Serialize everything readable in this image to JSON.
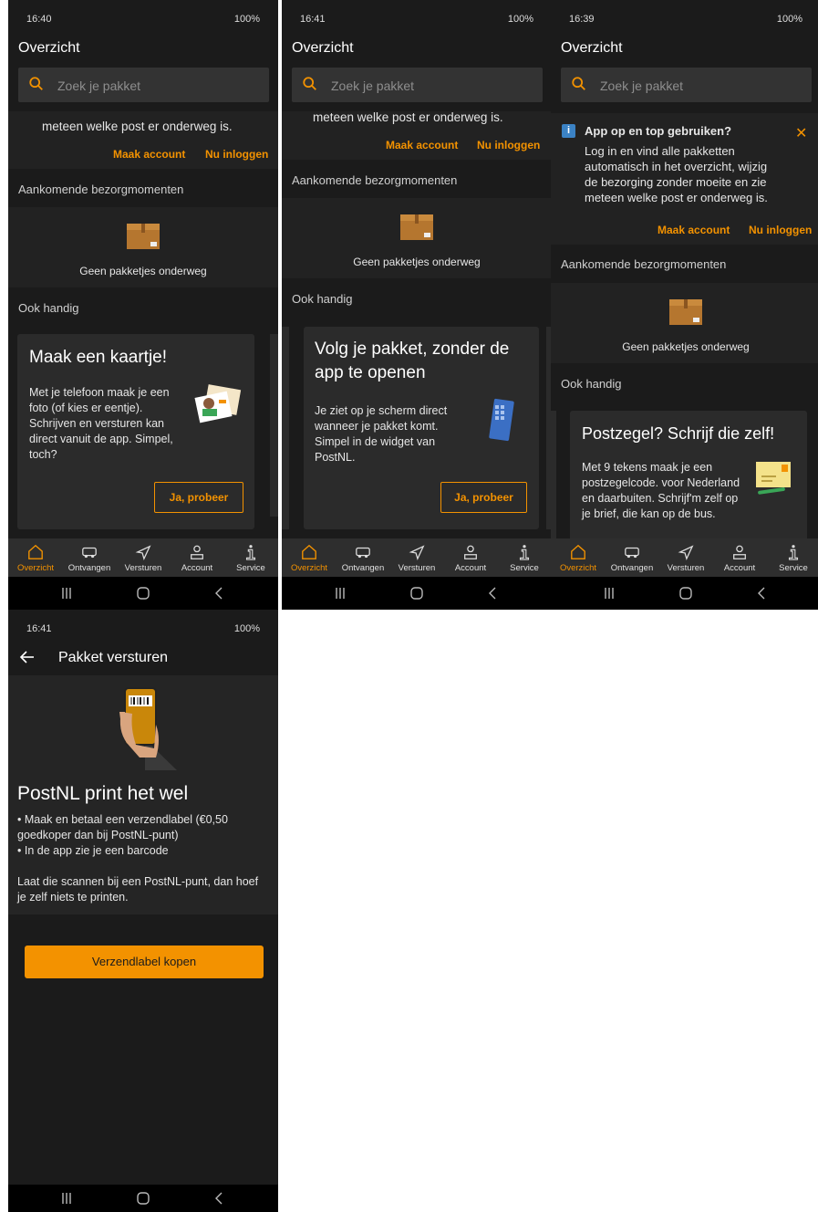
{
  "common": {
    "title": "Overzicht",
    "search_placeholder": "Zoek je pakket",
    "section_upcoming": "Aankomende bezorgmomenten",
    "no_packages": "Geen pakketjes onderweg",
    "section_handy": "Ook handig",
    "make_account": "Maak account",
    "login_now": "Nu inloggen",
    "account_text_tail": "meteen welke post er onderweg is.",
    "nav": [
      {
        "label": "Overzicht",
        "icon": "home-icon",
        "active": true
      },
      {
        "label": "Ontvangen",
        "icon": "van-icon",
        "active": false
      },
      {
        "label": "Versturen",
        "icon": "send-icon",
        "active": false
      },
      {
        "label": "Account",
        "icon": "person-icon",
        "active": false
      },
      {
        "label": "Service",
        "icon": "info-icon",
        "active": false
      }
    ],
    "status_right": "100%",
    "colors": {
      "accent": "#f39200",
      "background": "#1b1b1b",
      "card": "#2b2b2b",
      "info": "#3b82c4"
    }
  },
  "screen1": {
    "time": "16:40",
    "card_title": "Maak een kaartje!",
    "card_body": "Met je telefoon maak je een foto (of kies er eentje). Schrijven en versturen kan direct vanuit de app. Simpel, toch?",
    "card_button": "Ja, probeer"
  },
  "screen2": {
    "time": "16:41",
    "card_title": "Volg je pakket, zonder de app te openen",
    "card_body": "Je ziet op je scherm direct wanneer je pakket komt. Simpel in de widget van PostNL.",
    "card_button": "Ja, probeer"
  },
  "screen3": {
    "time": "16:39",
    "banner_title": "App op en top gebruiken?",
    "banner_body": "Log in en vind alle pakketten automatisch in het overzicht, wijzig de bezorging zonder moeite en zie meteen welke post er onderweg is.",
    "card_title": "Postzegel? Schrijf die zelf!",
    "card_body": "Met 9 tekens maak je een postzegelcode. voor Nederland en daarbuiten. Schrijf'm zelf op je brief, die kan op de bus."
  },
  "screen4": {
    "time": "16:41",
    "title": "Pakket versturen",
    "heading": "PostNL print het wel",
    "bullet1": "• Maak en betaal een verzendlabel (€0,50 goedkoper dan bij PostNL-punt)",
    "bullet2": "• In de app zie je een barcode",
    "paragraph": "Laat die scannen bij een PostNL-punt, dan hoef je zelf niets te printen.",
    "button": "Verzendlabel kopen"
  }
}
